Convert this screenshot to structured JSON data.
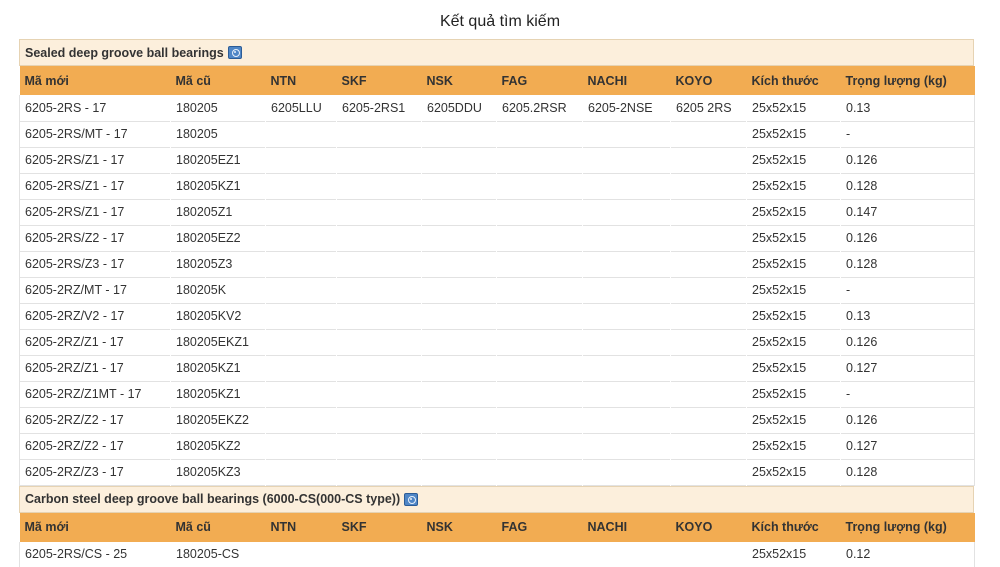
{
  "page_title": "Kết quả tìm kiếm",
  "columns": [
    "Mã mới",
    "Mã cũ",
    "NTN",
    "SKF",
    "NSK",
    "FAG",
    "NACHI",
    "KOYO",
    "Kích thước",
    "Trọng lượng (kg)"
  ],
  "sections": [
    {
      "title": "Sealed deep groove ball bearings",
      "icon": "catalog-icon",
      "rows": [
        [
          "6205-2RS - 17",
          "180205",
          "6205LLU",
          "6205-2RS1",
          "6205DDU",
          "6205.2RSR",
          "6205-2NSE",
          "6205 2RS",
          "25x52x15",
          "0.13"
        ],
        [
          "6205-2RS/MT - 17",
          "180205",
          "",
          "",
          "",
          "",
          "",
          "",
          "25x52x15",
          "-"
        ],
        [
          "6205-2RS/Z1 - 17",
          "180205EZ1",
          "",
          "",
          "",
          "",
          "",
          "",
          "25x52x15",
          "0.126"
        ],
        [
          "6205-2RS/Z1 - 17",
          "180205KZ1",
          "",
          "",
          "",
          "",
          "",
          "",
          "25x52x15",
          "0.128"
        ],
        [
          "6205-2RS/Z1 - 17",
          "180205Z1",
          "",
          "",
          "",
          "",
          "",
          "",
          "25x52x15",
          "0.147"
        ],
        [
          "6205-2RS/Z2 - 17",
          "180205EZ2",
          "",
          "",
          "",
          "",
          "",
          "",
          "25x52x15",
          "0.126"
        ],
        [
          "6205-2RS/Z3 - 17",
          "180205Z3",
          "",
          "",
          "",
          "",
          "",
          "",
          "25x52x15",
          "0.128"
        ],
        [
          "6205-2RZ/MT - 17",
          "180205K",
          "",
          "",
          "",
          "",
          "",
          "",
          "25x52x15",
          "-"
        ],
        [
          "6205-2RZ/V2 - 17",
          "180205KV2",
          "",
          "",
          "",
          "",
          "",
          "",
          "25x52x15",
          "0.13"
        ],
        [
          "6205-2RZ/Z1 - 17",
          "180205EKZ1",
          "",
          "",
          "",
          "",
          "",
          "",
          "25x52x15",
          "0.126"
        ],
        [
          "6205-2RZ/Z1 - 17",
          "180205KZ1",
          "",
          "",
          "",
          "",
          "",
          "",
          "25x52x15",
          "0.127"
        ],
        [
          "6205-2RZ/Z1MT - 17",
          "180205KZ1",
          "",
          "",
          "",
          "",
          "",
          "",
          "25x52x15",
          "-"
        ],
        [
          "6205-2RZ/Z2 - 17",
          "180205EKZ2",
          "",
          "",
          "",
          "",
          "",
          "",
          "25x52x15",
          "0.126"
        ],
        [
          "6205-2RZ/Z2 - 17",
          "180205KZ2",
          "",
          "",
          "",
          "",
          "",
          "",
          "25x52x15",
          "0.127"
        ],
        [
          "6205-2RZ/Z3 - 17",
          "180205KZ3",
          "",
          "",
          "",
          "",
          "",
          "",
          "25x52x15",
          "0.128"
        ]
      ]
    },
    {
      "title": "Carbon steel deep groove ball bearings (6000-CS(000-CS type))",
      "icon": "catalog-icon",
      "rows": [
        [
          "6205-2RS/CS - 25",
          "180205-CS",
          "",
          "",
          "",
          "",
          "",
          "",
          "25x52x15",
          "0.12"
        ]
      ]
    }
  ]
}
